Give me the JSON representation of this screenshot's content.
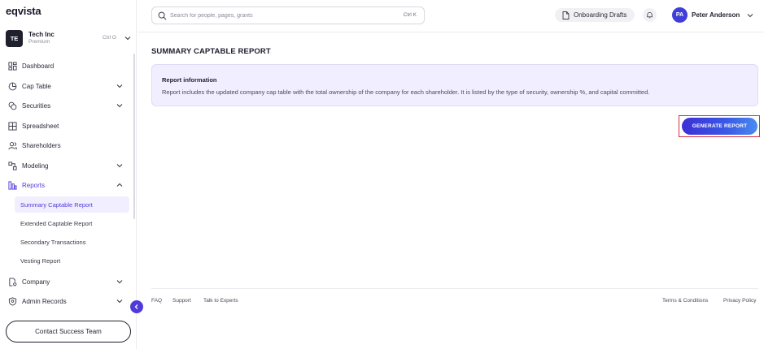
{
  "sidebar": {
    "logo": "eqvista",
    "company": {
      "initials": "TE",
      "name": "Tech Inc",
      "plan": "Premium",
      "shortcut": "Ctrl O"
    },
    "nav": [
      {
        "label": "Dashboard",
        "icon": "dashboard-icon",
        "expandable": false
      },
      {
        "label": "Cap Table",
        "icon": "pie-chart-icon",
        "expandable": true
      },
      {
        "label": "Securities",
        "icon": "coins-icon",
        "expandable": true
      },
      {
        "label": "Spreadsheet",
        "icon": "grid-icon",
        "expandable": false
      },
      {
        "label": "Shareholders",
        "icon": "users-icon",
        "expandable": false
      },
      {
        "label": "Modeling",
        "icon": "modeling-icon",
        "expandable": true
      },
      {
        "label": "Reports",
        "icon": "reports-icon",
        "expandable": true,
        "expanded": true
      }
    ],
    "reports_sub": [
      {
        "label": "Summary Captable Report",
        "active": true
      },
      {
        "label": "Extended Captable Report",
        "active": false
      },
      {
        "label": "Secondary Transactions",
        "active": false
      },
      {
        "label": "Vesting Report",
        "active": false
      }
    ],
    "nav_bottom": [
      {
        "label": "Company",
        "icon": "company-icon",
        "expandable": true
      },
      {
        "label": "Admin Records",
        "icon": "shield-icon",
        "expandable": true
      }
    ],
    "contact_label": "Contact Success Team"
  },
  "header": {
    "search": {
      "placeholder": "Search for people, pages, grants",
      "value": "",
      "shortcut": "Ctrl K"
    },
    "drafts_label": "Onboarding Drafts",
    "user": {
      "initials": "PA",
      "name": "Peter Anderson"
    }
  },
  "main": {
    "title": "SUMMARY CAPTABLE REPORT",
    "info": {
      "title": "Report information",
      "text": "Report includes the updated company cap table with the total ownership of the company for each shareholder. It is listed by the type of security, ownership %, and capital committed."
    },
    "generate_label": "GENERATE REPORT"
  },
  "footer": {
    "links_left": [
      "FAQ",
      "Support",
      "Talk to Experts"
    ],
    "links_right": [
      "Terms & Conditions",
      "Privacy Policy"
    ]
  },
  "colors": {
    "accent": "#4f3bd9",
    "card_bg": "#f1efff",
    "highlight_border": "#d83040"
  }
}
